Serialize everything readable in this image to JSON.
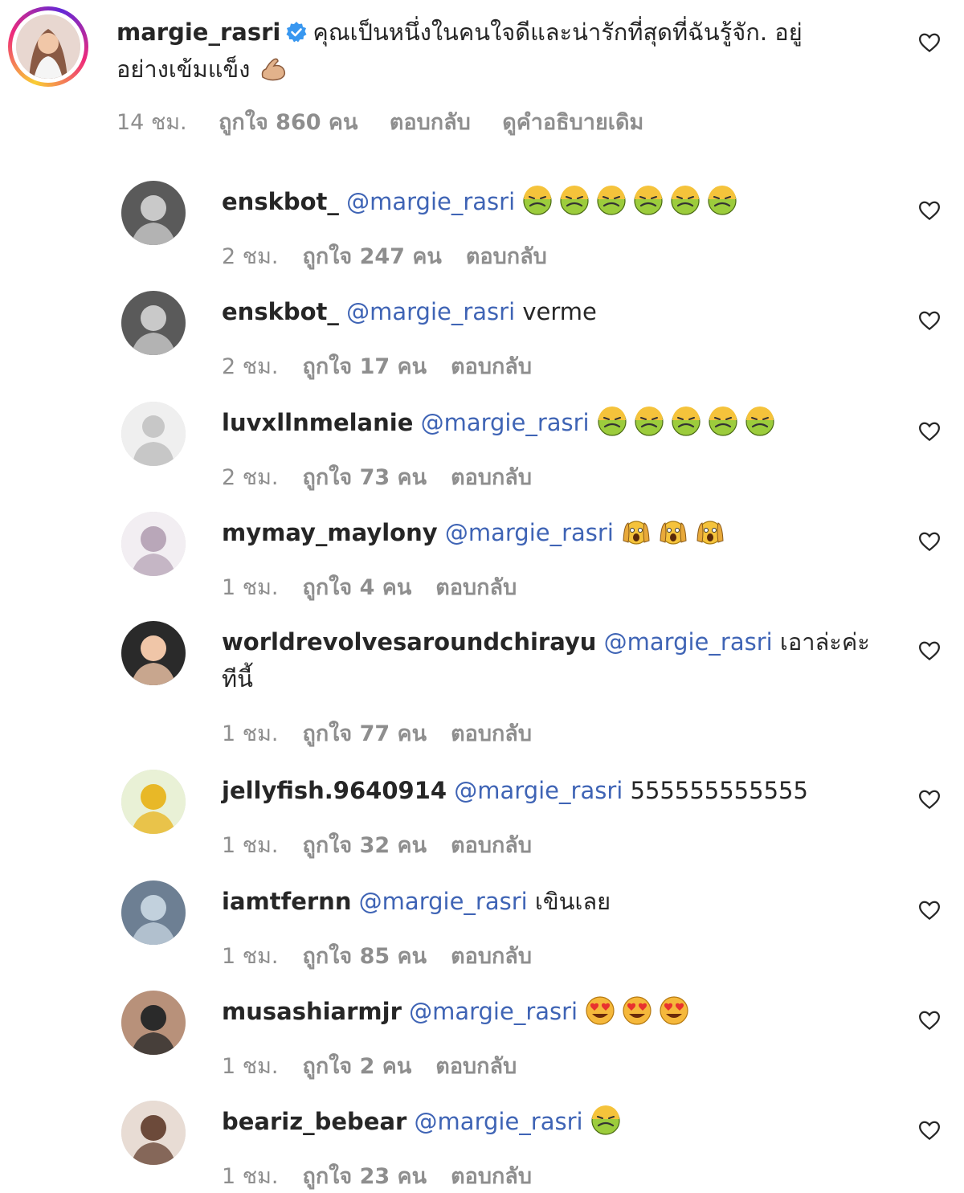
{
  "main_comment": {
    "username": "margie_rasri",
    "text_line1": "คุณเป็นหนึ่งในคนใจดีและน่ารักที่สุดที่ฉันรู้จัก. อยู่",
    "text_line2": "อย่างเข้มแข็ง",
    "time": "14 ชม.",
    "likes": "ถูกใจ 860 คน",
    "reply": "ตอบกลับ",
    "see_translation": "ดูคำอธิบายเดิม"
  },
  "mention": "@margie_rasri",
  "replies": [
    {
      "username": "enskbot_",
      "text": "",
      "emoji": "nauseated",
      "emoji_count": 6,
      "time": "2 ชม.",
      "likes": "ถูกใจ 247 คน",
      "reply": "ตอบกลับ"
    },
    {
      "username": "enskbot_",
      "text": "verme",
      "emoji": "",
      "emoji_count": 0,
      "time": "2 ชม.",
      "likes": "ถูกใจ 17 คน",
      "reply": "ตอบกลับ"
    },
    {
      "username": "luvxllnmelanie",
      "text": "",
      "emoji": "nauseated",
      "emoji_count": 5,
      "time": "2 ชม.",
      "likes": "ถูกใจ 73 คน",
      "reply": "ตอบกลับ"
    },
    {
      "username": "mymay_maylony",
      "text": "",
      "emoji": "screaming",
      "emoji_count": 3,
      "time": "1 ชม.",
      "likes": "ถูกใจ 4 คน",
      "reply": "ตอบกลับ"
    },
    {
      "username": "worldrevolvesaroundchirayu",
      "text": "เอาล่ะค่ะ",
      "text2": "ทีนี้",
      "emoji": "",
      "emoji_count": 0,
      "time": "1 ชม.",
      "likes": "ถูกใจ 77 คน",
      "reply": "ตอบกลับ"
    },
    {
      "username": "jellyfish.9640914",
      "text": "555555555555",
      "emoji": "",
      "emoji_count": 0,
      "time": "1 ชม.",
      "likes": "ถูกใจ 32 คน",
      "reply": "ตอบกลับ"
    },
    {
      "username": "iamtfernn",
      "text": "เขินเลย",
      "emoji": "",
      "emoji_count": 0,
      "time": "1 ชม.",
      "likes": "ถูกใจ 85 คน",
      "reply": "ตอบกลับ"
    },
    {
      "username": "musashiarmjr",
      "text": "",
      "emoji": "heart-eyes",
      "emoji_count": 3,
      "time": "1 ชม.",
      "likes": "ถูกใจ 2 คน",
      "reply": "ตอบกลับ"
    },
    {
      "username": "beariz_bebear",
      "text": "",
      "emoji": "nauseated",
      "emoji_count": 1,
      "time": "1 ชม.",
      "likes": "ถูกใจ 23 คน",
      "reply": "ตอบกลับ"
    }
  ],
  "colors": {
    "mention": "#3f64b5",
    "meta": "#8e8e8e",
    "verified": "#3897f0"
  }
}
